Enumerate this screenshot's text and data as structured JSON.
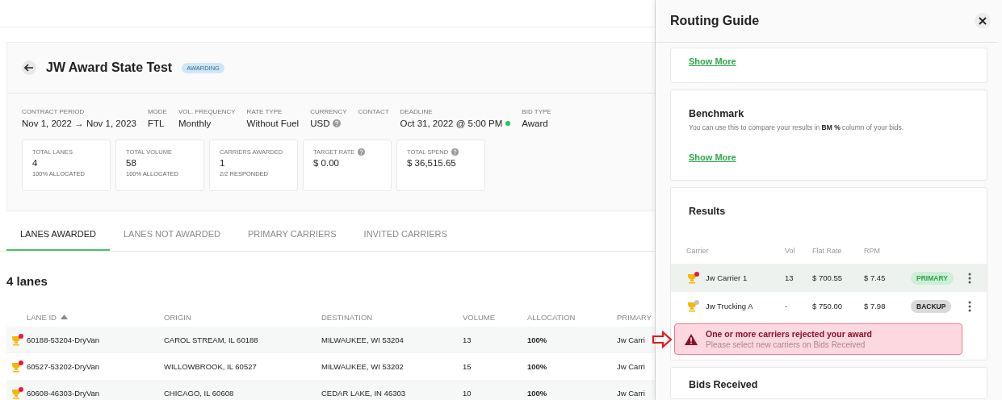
{
  "header": {
    "title": "JW Award State Test",
    "status": "AWARDING"
  },
  "details": [
    {
      "label": "CONTRACT PERIOD",
      "value": "Nov 1, 2022 → Nov 1, 2023"
    },
    {
      "label": "MODE",
      "value": "FTL"
    },
    {
      "label": "VOL. FREQUENCY",
      "value": "Monthly"
    },
    {
      "label": "RATE TYPE",
      "value": "Without Fuel"
    },
    {
      "label": "CURRENCY",
      "value": "USD",
      "help": true
    },
    {
      "label": "CONTACT"
    },
    {
      "label": "DEADLINE",
      "value": "Oct 31, 2022 @ 5:00 PM",
      "color": "#22c55e"
    },
    {
      "label": "BID TYPE",
      "value": "Award"
    }
  ],
  "stats": [
    {
      "label": "TOTAL LANES",
      "value": "4",
      "note": "100% ALLOCATED"
    },
    {
      "label": "TOTAL VOLUME",
      "value": "58",
      "note": "100% ALLOCATED"
    },
    {
      "label": "CARRIERS AWARDED",
      "value": "1",
      "note": "2/2 RESPONDED"
    },
    {
      "label": "TARGET RATE",
      "value": "$ 0.00",
      "help": true
    },
    {
      "label": "TOTAL SPEND",
      "value": "$ 36,515.65",
      "help": true
    }
  ],
  "tabs": [
    {
      "label": "LANES AWARDED",
      "selected": true
    },
    {
      "label": "LANES NOT AWARDED",
      "selected": false
    },
    {
      "label": "PRIMARY CARRIERS",
      "selected": false
    },
    {
      "label": "INVITED CARRIERS",
      "selected": false
    }
  ],
  "lanes_count": "4 lanes",
  "table": {
    "columns": [
      {
        "label": "LANE ID",
        "sorted": true
      },
      {
        "label": "ORIGIN",
        "sorted": false
      },
      {
        "label": "DESTINATION",
        "sorted": false
      },
      {
        "label": "VOLUME",
        "sorted": false
      },
      {
        "label": "ALLOCATION",
        "sorted": false
      },
      {
        "label": "PRIMARY",
        "sorted": false
      }
    ],
    "rows": [
      {
        "color": "#e8174a",
        "lane_id": "60188-53204-DryVan",
        "origin": "CAROL STREAM, IL 60188",
        "destination": "MILWAUKEE, WI 53204",
        "volume": "13",
        "allocation": "100%",
        "primary": "Jw Carri"
      },
      {
        "color": "#e8174a",
        "lane_id": "60527-53202-DryVan",
        "origin": "WILLOWBROOK, IL 60527",
        "destination": "MILWAUKEE, WI 53202",
        "volume": "15",
        "allocation": "100%",
        "primary": "Jw Carri"
      },
      {
        "color": "#e8174a",
        "lane_id": "60608-46303-DryVan",
        "origin": "CHICAGO, IL 60608",
        "destination": "CEDAR LAKE, IN 46303",
        "volume": "10",
        "allocation": "100%",
        "primary": "Jw Carri"
      }
    ]
  },
  "panel": {
    "title": "Routing Guide",
    "top_card": {
      "link": "Show More"
    },
    "benchmark": {
      "title": "Benchmark",
      "description": "You can use this to compare your results in **BM %** column of your bids.",
      "link": "Show More"
    },
    "results": {
      "title": "Results",
      "columns": [
        "Carrier",
        "Vol",
        "Flat Rate",
        "RPM"
      ],
      "carriers": [
        {
          "color": "#e8174a",
          "name": "Jw Carrier 1",
          "vol": "13",
          "flat_rate": "$ 700.55",
          "rpm": "$ 7.45",
          "role": {
            "kind": "primary",
            "label": "PRIMARY"
          },
          "selected": true
        },
        {
          "color": "#c4c4c4",
          "name": "Jw Trucking A",
          "vol": "-",
          "flat_rate": "$ 750.00",
          "rpm": "$ 7.98",
          "role": {
            "kind": "backup",
            "label": "BACKUP"
          },
          "selected": false
        }
      ],
      "alert": {
        "title": "One or more carriers rejected your award",
        "message": "Please select new carriers on Bids Received"
      }
    },
    "next_section": "Bids Received"
  }
}
